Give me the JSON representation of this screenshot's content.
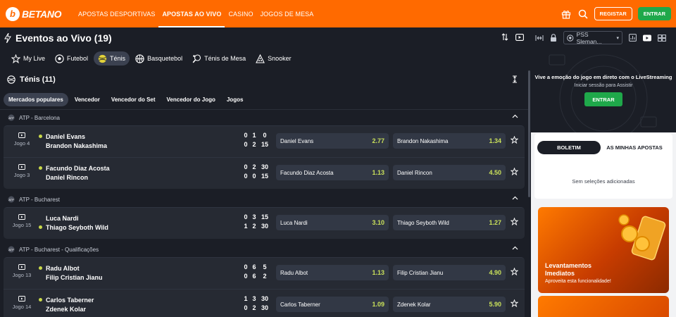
{
  "brand": {
    "name": "BETANO",
    "mark": "b"
  },
  "nav": [
    {
      "label": "APOSTAS DESPORTIVAS",
      "active": false
    },
    {
      "label": "APOSTAS AO VIVO",
      "active": true
    },
    {
      "label": "CASINO",
      "active": false
    },
    {
      "label": "JOGOS DE MESA",
      "active": false
    }
  ],
  "header_actions": {
    "register": "REGISTAR",
    "login": "ENTRAR"
  },
  "page": {
    "title": "Eventos ao Vivo (19)"
  },
  "stream_select": {
    "value": "PSS Sleman..."
  },
  "sports": [
    {
      "label": "My Live",
      "icon": "star-icon"
    },
    {
      "label": "Futebol",
      "icon": "soccer-ball-icon"
    },
    {
      "label": "Ténis",
      "icon": "tennis-ball-icon",
      "active": true
    },
    {
      "label": "Basquetebol",
      "icon": "basketball-icon"
    },
    {
      "label": "Ténis de Mesa",
      "icon": "table-tennis-icon"
    },
    {
      "label": "Snooker",
      "icon": "snooker-icon"
    }
  ],
  "section": {
    "title": "Ténis (11)"
  },
  "markets": [
    {
      "label": "Mercados populares",
      "active": true
    },
    {
      "label": "Vencedor"
    },
    {
      "label": "Vencedor do Set"
    },
    {
      "label": "Vencedor do Jogo"
    },
    {
      "label": "Jogos"
    }
  ],
  "leagues": [
    {
      "name": "ATP - Barcelona"
    },
    {
      "name": "ATP - Bucharest"
    },
    {
      "name": "ATP - Bucharest - Qualificações"
    }
  ],
  "matches": [
    {
      "game": "Jogo 4",
      "p1": "Daniel Evans",
      "p2": "Brandon Nakashima",
      "s1": [
        "0",
        "1",
        "0"
      ],
      "s2": [
        "0",
        "2",
        "15"
      ],
      "o1": "2.77",
      "o2": "1.34"
    },
    {
      "game": "Jogo 3",
      "p1": "Facundo Diaz Acosta",
      "p2": "Daniel Rincon",
      "s1": [
        "0",
        "2",
        "30"
      ],
      "s2": [
        "0",
        "0",
        "15"
      ],
      "o1": "1.13",
      "o2": "4.50"
    },
    {
      "game": "Jogo 15",
      "p1": "Luca Nardi",
      "p2": "Thiago Seyboth Wild",
      "s1": [
        "0",
        "3",
        "15"
      ],
      "s2": [
        "1",
        "2",
        "30"
      ],
      "o1": "3.10",
      "o2": "1.27"
    },
    {
      "game": "Jogo 13",
      "p1": "Radu Albot",
      "p2": "Filip Cristian Jianu",
      "s1": [
        "0",
        "6",
        "5"
      ],
      "s2": [
        "0",
        "6",
        "2"
      ],
      "o1": "1.13",
      "o2": "4.90"
    },
    {
      "game": "Jogo 14",
      "p1": "Carlos Taberner",
      "p2": "Zdenek Kolar",
      "s1": [
        "1",
        "3",
        "30"
      ],
      "s2": [
        "0",
        "2",
        "30"
      ],
      "o1": "1.09",
      "o2": "5.90"
    }
  ],
  "stream": {
    "text": "Vive a emoção do jogo em direto com o LiveStreaming",
    "sub": "Iniciar sessão para Assistir",
    "button": "ENTRAR"
  },
  "betslip": {
    "tab_active": "BOLETIM",
    "tab_inactive": "AS MINHAS APOSTAS",
    "empty": "Sem seleções adicionadas"
  },
  "promo": {
    "title": "Levantamentos Imediatos",
    "subtitle": "Aproveita esta funcionalidade!"
  },
  "colors": {
    "brand": "#ff6a00",
    "accent_green": "#1fa84a",
    "odd": "#c9e05a"
  }
}
